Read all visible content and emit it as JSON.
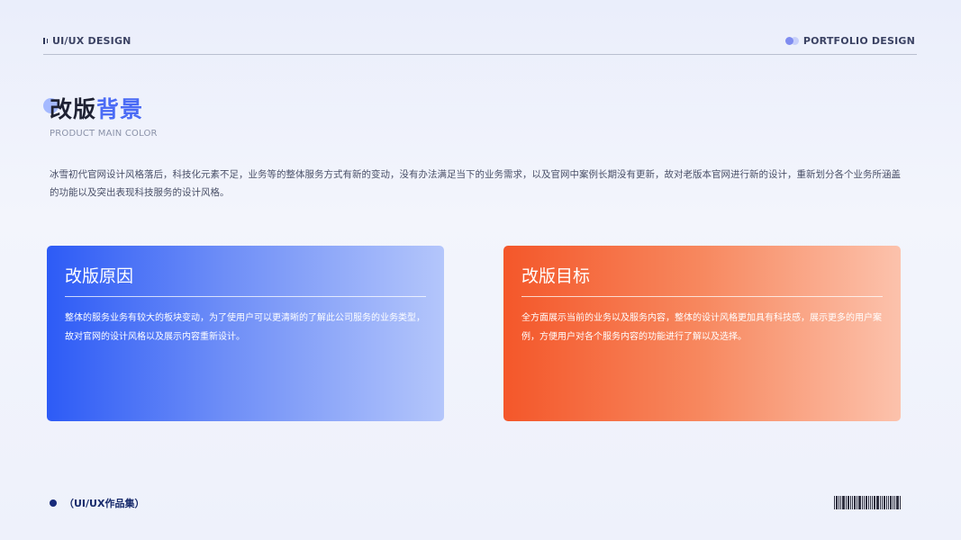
{
  "header": {
    "left_label": "UI/UX DESIGN",
    "right_label": "PORTFOLIO DESIGN"
  },
  "title": {
    "part1": "改版",
    "part2": "背景",
    "subtitle": "PRODUCT MAIN COLOR",
    "accent_color": "#4b6bf5"
  },
  "intro": "冰雪初代官网设计风格落后，科技化元素不足，业务等的整体服务方式有新的变动，没有办法满足当下的业务需求，以及官网中案例长期没有更新，故对老版本官网进行新的设计，重新划分各个业务所涵盖的功能以及突出表现科技服务的设计风格。",
  "cards": [
    {
      "title": "改版原因",
      "text": "整体的服务业务有较大的板块变动，为了使用户可以更清晰的了解此公司服务的业务类型，故对官网的设计风格以及展示内容重新设计。",
      "color": "#2d5bf6"
    },
    {
      "title": "改版目标",
      "text": "全方面展示当前的业务以及服务内容，整体的设计风格更加具有科技感，展示更多的用户案例，方便用户对各个服务内容的功能进行了解以及选择。",
      "color": "#f4572a"
    }
  ],
  "footer": {
    "label": "（UI/UX作品集）"
  },
  "icons": {
    "header_left": "bars-icon",
    "header_right": "toggle-icon",
    "footer_right": "barcode-icon"
  }
}
